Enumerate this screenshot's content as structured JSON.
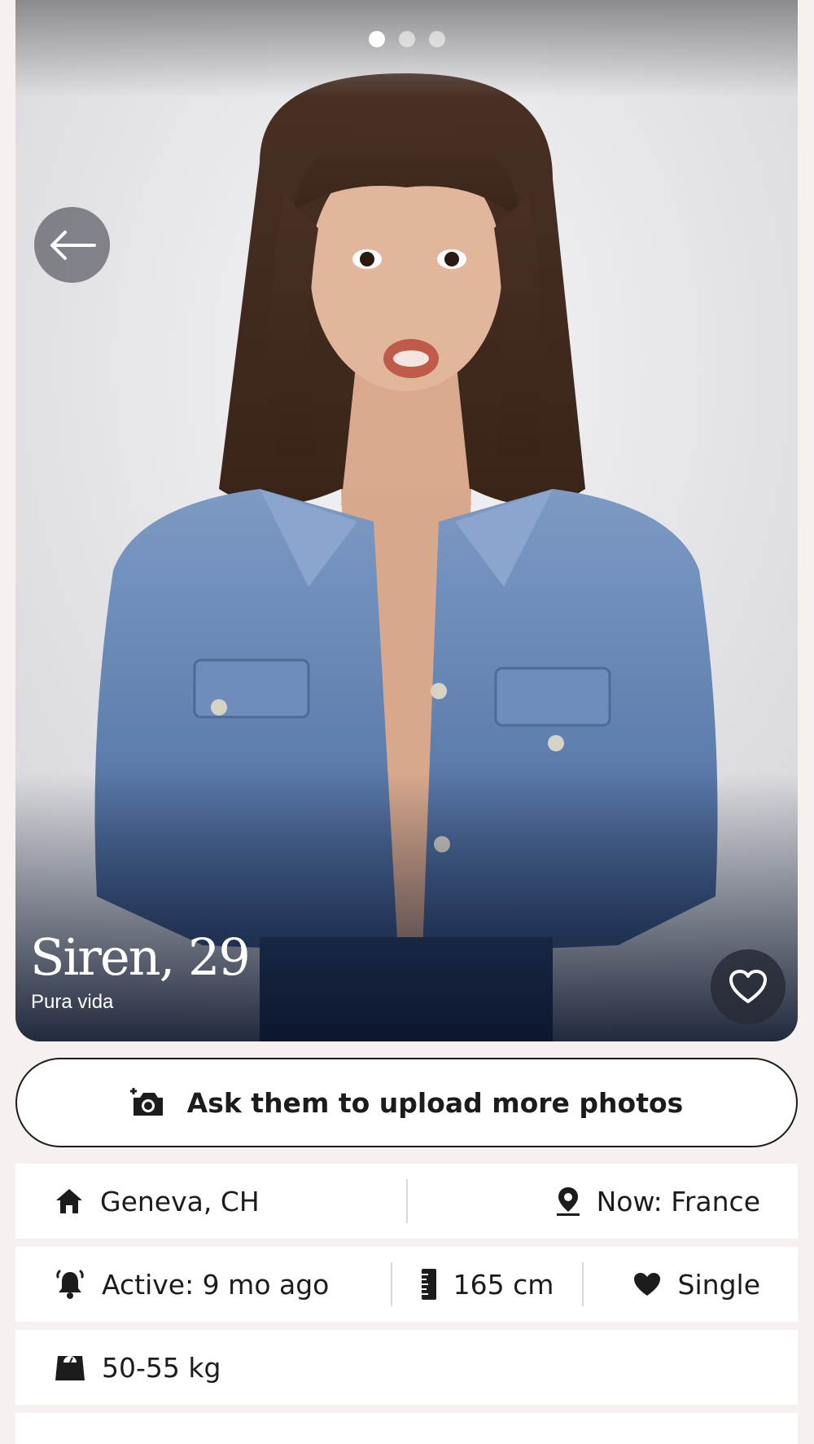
{
  "profile": {
    "name_age": "Siren, 29",
    "tagline": "Pura vida",
    "photo_count": 3,
    "active_photo_index": 1
  },
  "actions": {
    "ask_photos_label": "Ask them to upload more photos"
  },
  "details": {
    "home": "Geneva, CH",
    "current_location": "Now: France",
    "activity": "Active: 9 mo ago",
    "height": "165 cm",
    "relationship": "Single",
    "weight": "50-55 kg"
  },
  "icons": {
    "back": "arrow-left-icon",
    "like": "heart-outline-icon",
    "camera": "camera-plus-icon",
    "home": "home-icon",
    "location": "map-pin-icon",
    "activity": "bell-icon",
    "height": "ruler-icon",
    "relationship": "heart-icon",
    "weight": "scale-icon"
  },
  "colors": {
    "background": "#f6f1ee",
    "card": "#ffffff",
    "text": "#1c1c1c",
    "divider": "#d9d9d9"
  }
}
